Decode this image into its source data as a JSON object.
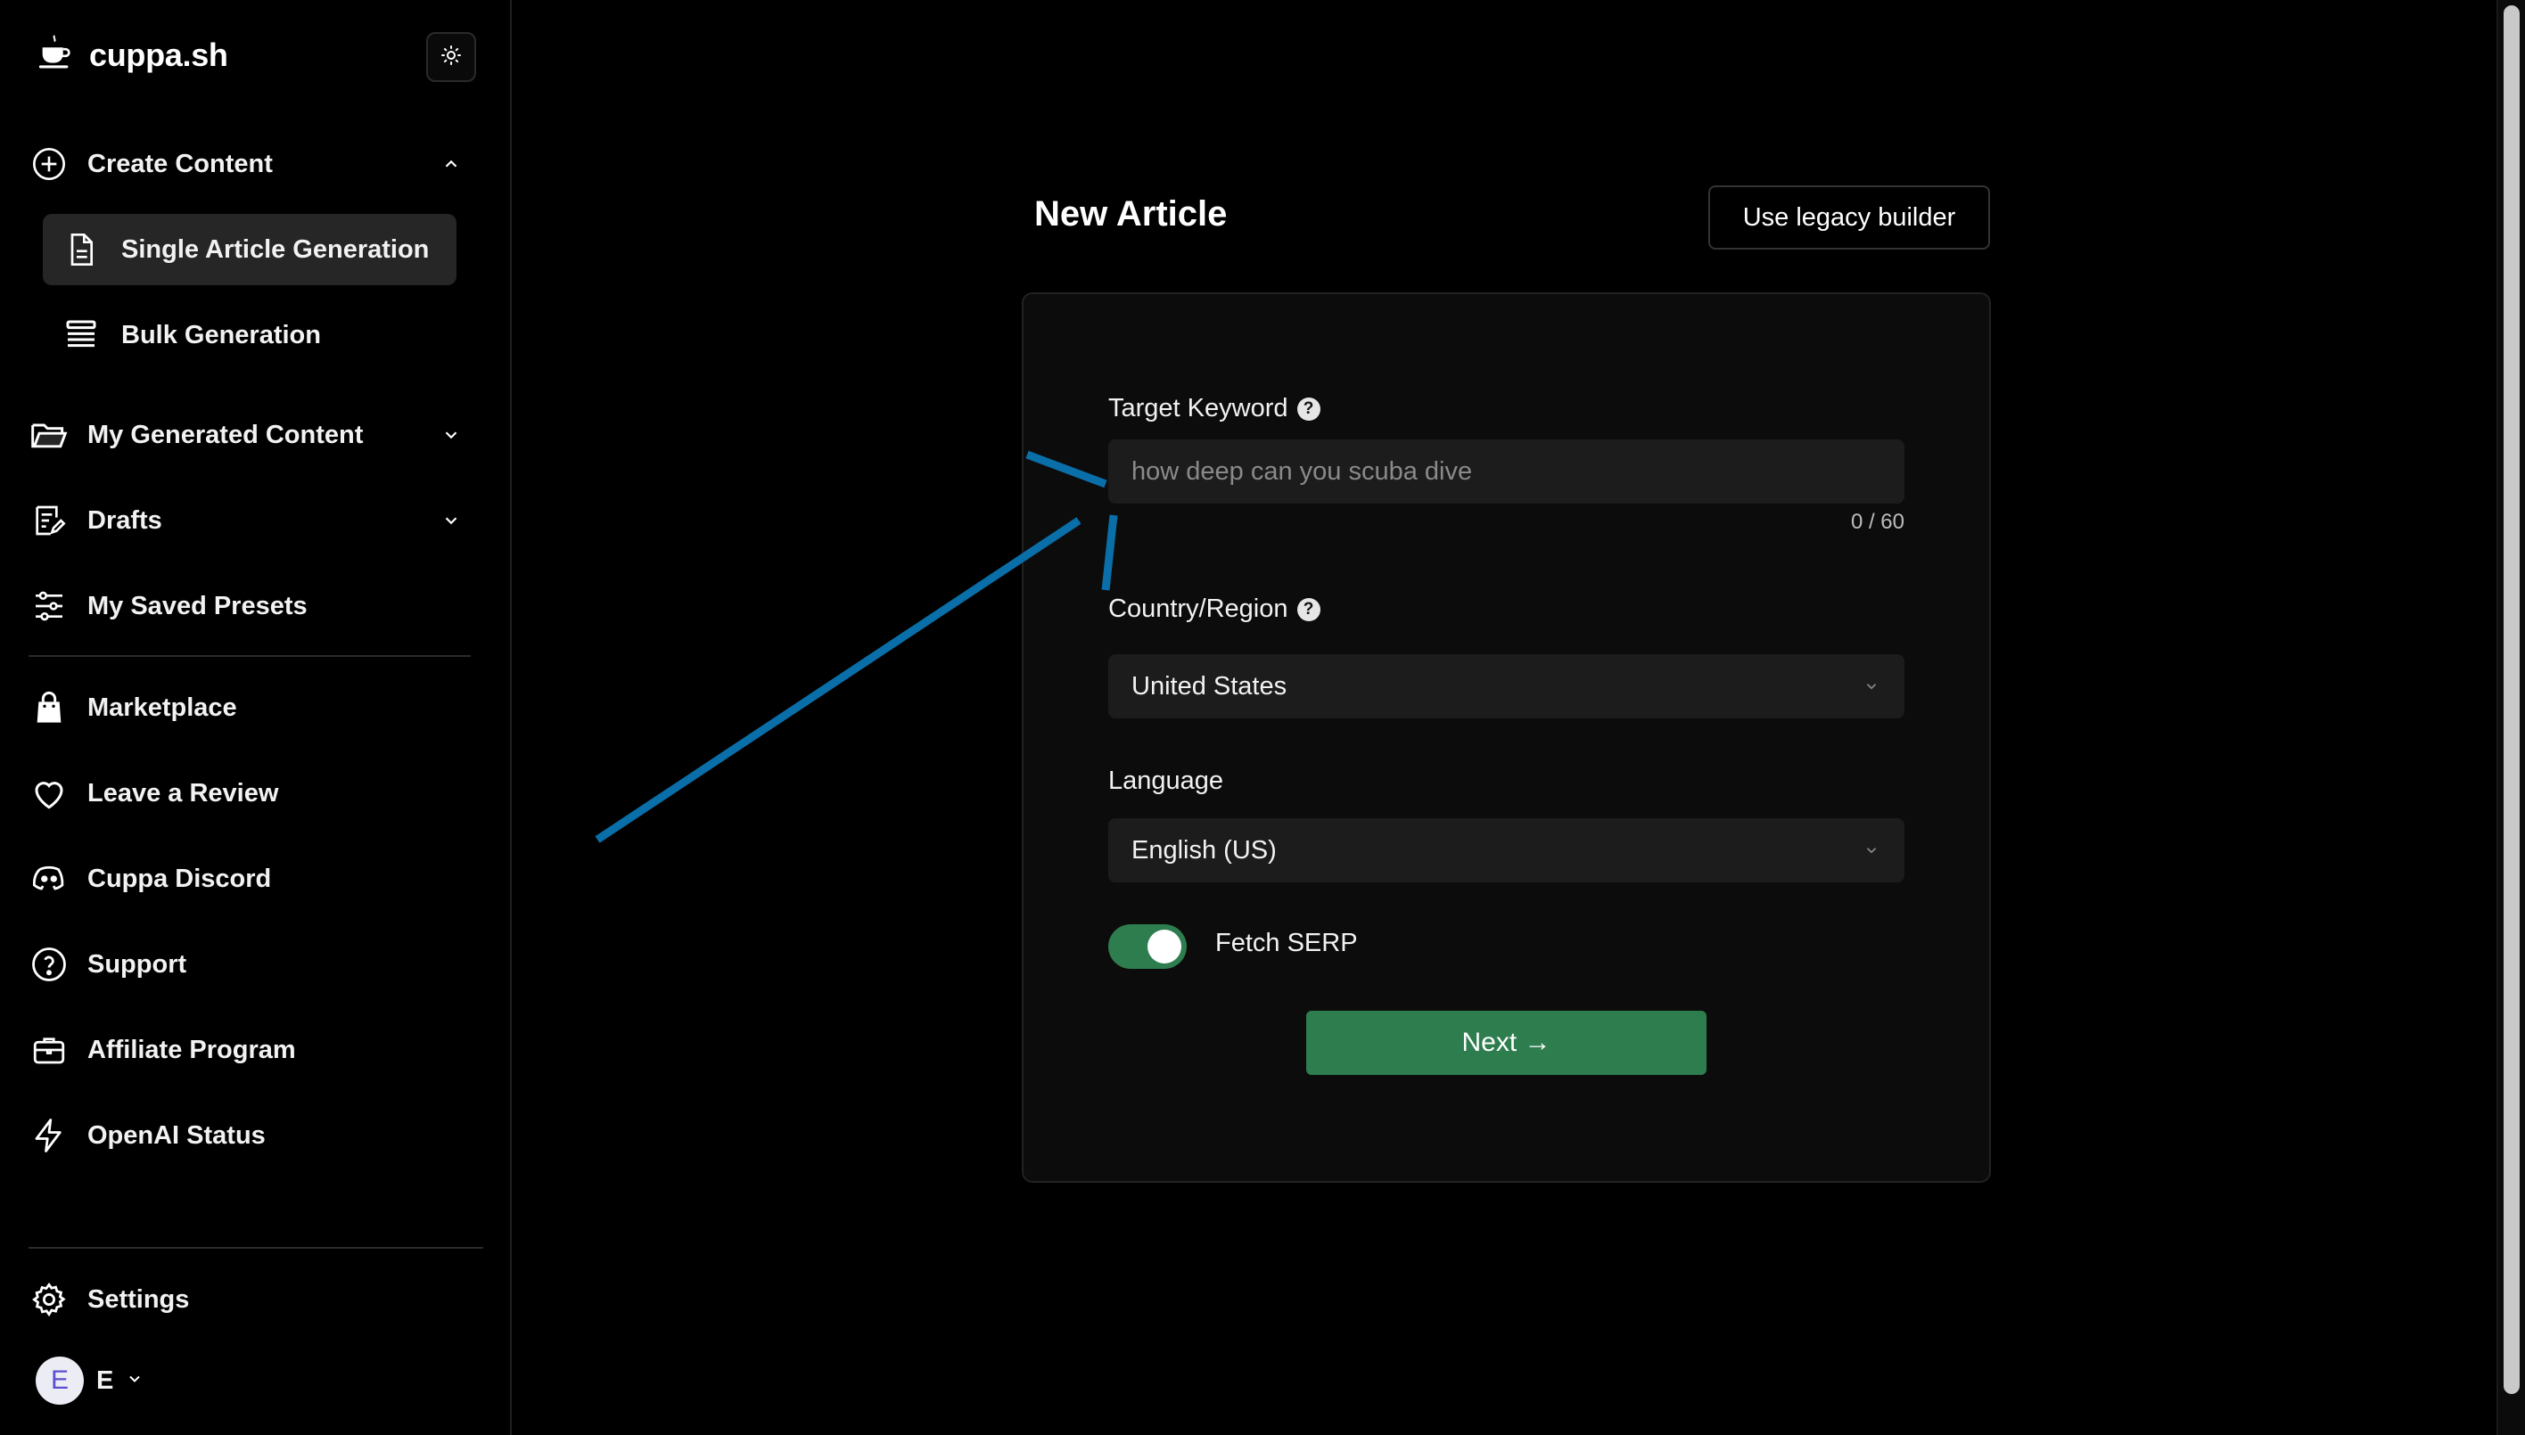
{
  "brand": {
    "name": "cuppa.sh"
  },
  "sidebar": {
    "create_content": "Create Content",
    "sub_items": [
      {
        "label": "Single Article Generation"
      },
      {
        "label": "Bulk Generation"
      }
    ],
    "items": [
      {
        "label": "My Generated Content"
      },
      {
        "label": "Drafts"
      },
      {
        "label": "My Saved Presets"
      },
      {
        "label": "Marketplace"
      },
      {
        "label": "Leave a Review"
      },
      {
        "label": "Cuppa Discord"
      },
      {
        "label": "Support"
      },
      {
        "label": "Affiliate Program"
      },
      {
        "label": "OpenAI Status"
      },
      {
        "label": "Settings"
      }
    ],
    "user": {
      "avatar_letter": "E",
      "name": "E"
    }
  },
  "main": {
    "title": "New Article",
    "legacy_button": "Use legacy builder",
    "target_keyword": {
      "label": "Target Keyword",
      "placeholder": "how deep can you scuba dive",
      "counter": "0 / 60"
    },
    "country": {
      "label": "Country/Region",
      "value": "United States"
    },
    "language": {
      "label": "Language",
      "value": "English (US)"
    },
    "fetch_serp": {
      "label": "Fetch SERP",
      "enabled": true
    },
    "next_button": "Next →"
  },
  "colors": {
    "accent_green": "#2e7d4f",
    "annotation_blue": "#0a6ea8",
    "background": "#000000",
    "card": "#0c0c0c",
    "input": "#1c1c1c"
  },
  "icons": {
    "brand": "coffee-cup-icon",
    "theme": "sun-icon"
  }
}
